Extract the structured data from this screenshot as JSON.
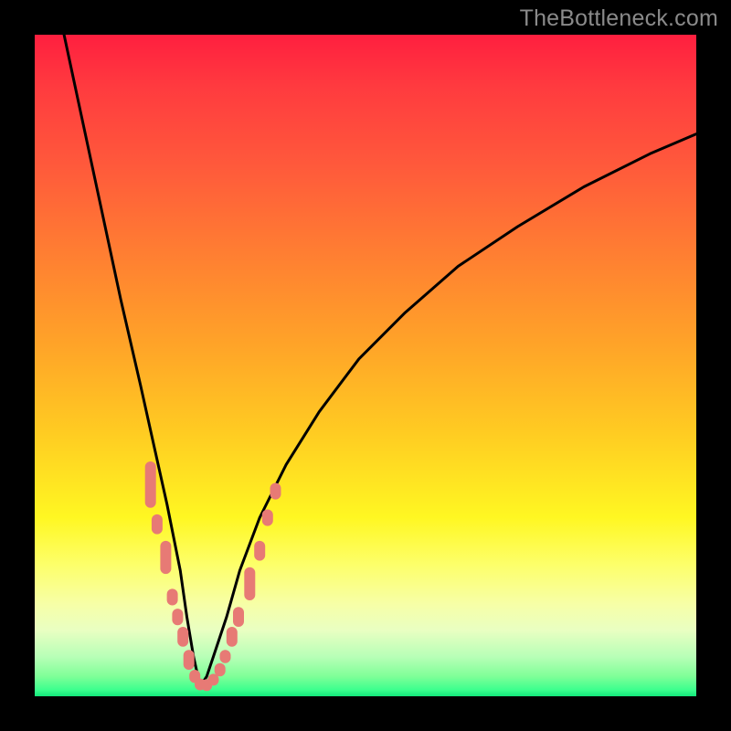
{
  "watermark": "TheBottleneck.com",
  "colors": {
    "background": "#000000",
    "curve": "#000000",
    "markers": "#e77a75",
    "watermark": "#8a8a8a",
    "gradient_top": "#ff1f3f",
    "gradient_bottom": "#12e87b"
  },
  "chart_data": {
    "type": "line",
    "title": "",
    "xlabel": "",
    "ylabel": "",
    "xlim": [
      0,
      100
    ],
    "ylim": [
      0,
      100
    ],
    "grid": false,
    "note": "Values are read off pixel positions and normalized to a 0–100 range on both axes. x ≈ horizontal position percentage, y ≈ height above bottom edge as percentage. The curve is a V-shaped bottleneck curve; minimum ≈ (25, 1.5).",
    "series": [
      {
        "name": "bottleneck-curve",
        "x": [
          4,
          7,
          10,
          13,
          16,
          18,
          20,
          22,
          23,
          24,
          25,
          26,
          27,
          29,
          31,
          34,
          38,
          43,
          49,
          56,
          64,
          73,
          83,
          93,
          100
        ],
        "y": [
          102,
          88,
          74,
          60,
          47,
          38,
          29,
          19,
          12,
          6,
          1.5,
          3,
          6,
          12,
          19,
          27,
          35,
          43,
          51,
          58,
          65,
          71,
          77,
          82,
          85
        ]
      }
    ],
    "markers": {
      "name": "salmon-beads",
      "shape": "rounded-rect",
      "note": "Short pill-shaped salmon markers overlaid near the bottom of the V, on both arms. Coordinates are (x%, y%) with same normalization as the curve; len is approximate vertical extent in % units.",
      "points": [
        {
          "x": 17.5,
          "y": 32,
          "len": 7
        },
        {
          "x": 18.5,
          "y": 26,
          "len": 3
        },
        {
          "x": 19.8,
          "y": 21,
          "len": 5
        },
        {
          "x": 20.8,
          "y": 15,
          "len": 2.5
        },
        {
          "x": 21.6,
          "y": 12,
          "len": 2.5
        },
        {
          "x": 22.4,
          "y": 9,
          "len": 3
        },
        {
          "x": 23.3,
          "y": 5.5,
          "len": 3
        },
        {
          "x": 24.2,
          "y": 3,
          "len": 2
        },
        {
          "x": 25.0,
          "y": 1.8,
          "len": 1.8
        },
        {
          "x": 26.0,
          "y": 1.7,
          "len": 1.8
        },
        {
          "x": 27.0,
          "y": 2.5,
          "len": 1.8
        },
        {
          "x": 28.0,
          "y": 4,
          "len": 2
        },
        {
          "x": 28.8,
          "y": 6,
          "len": 2
        },
        {
          "x": 29.8,
          "y": 9,
          "len": 3
        },
        {
          "x": 30.8,
          "y": 12,
          "len": 3
        },
        {
          "x": 32.5,
          "y": 17,
          "len": 5
        },
        {
          "x": 34.0,
          "y": 22,
          "len": 3
        },
        {
          "x": 35.2,
          "y": 27,
          "len": 2.5
        },
        {
          "x": 36.4,
          "y": 31,
          "len": 2.5
        }
      ]
    }
  }
}
